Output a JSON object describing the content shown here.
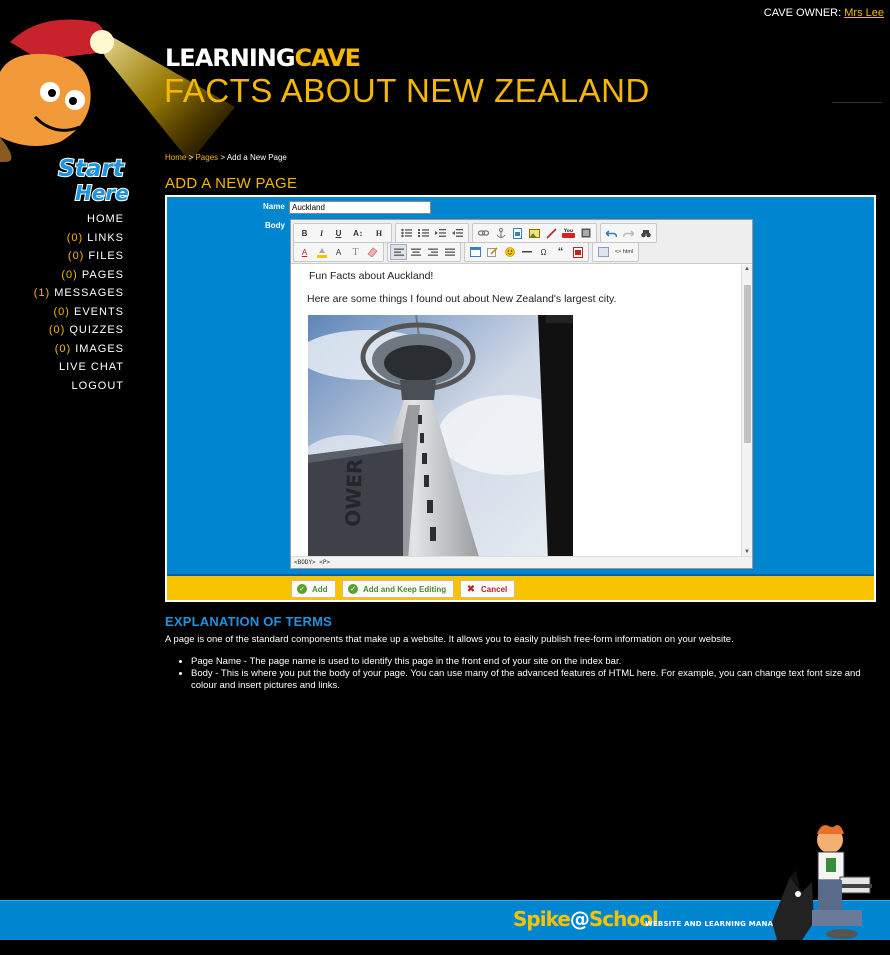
{
  "header": {
    "owner_label": "CAVE OWNER:",
    "owner_name": "Mrs Lee",
    "logo_part1": "LEARNING",
    "logo_part2": "CAVE",
    "site_title": "FACTS ABOUT NEW ZEALAND"
  },
  "start_here": "Start Here",
  "nav": {
    "home": "HOME",
    "links_count": "(0)",
    "links": "LINKS",
    "files_count": "(0)",
    "files": "FILES",
    "pages_count": "(0)",
    "pages": "PAGES",
    "messages_count": "(1)",
    "messages": "MESSAGES",
    "events_count": "(0)",
    "events": "EVENTS",
    "quizzes_count": "(0)",
    "quizzes": "QUIZZES",
    "images_count": "(0)",
    "images": "IMAGES",
    "live_chat": "LIVE CHAT",
    "logout": "LOGOUT"
  },
  "breadcrumb": {
    "home": "Home",
    "sep1": " > ",
    "pages": "Pages",
    "sep2": " > ",
    "current": "Add a New Page"
  },
  "page_heading": "ADD A NEW PAGE",
  "form": {
    "name_label": "Name",
    "name_value": "Auckland",
    "body_label": "Body",
    "editor_title": "Fun Facts about Auckland!",
    "editor_text": "Here are some things I found out about New Zealand's largest city.",
    "status_path": "<BODY> <P>",
    "add_button": "Add",
    "add_keep_button": "Add and Keep Editing",
    "cancel_button": "Cancel"
  },
  "toolbar": {
    "bold": "B",
    "italic": "I",
    "underline": "U",
    "font_size": "A↕",
    "heading": "H",
    "text_style": "T",
    "special_char": "Ω",
    "quote": "“",
    "html": "<> html"
  },
  "explanation": {
    "heading": "EXPLANATION OF TERMS",
    "intro": "A page is one of the standard components that make up a website. It allows you to easily publish free-form information on your website.",
    "items": [
      "Page Name - The page name is used to identify this page in the front end of your site on the index bar.",
      "Body - This is where you put the body of your page. You can use many of the advanced features of HTML here. For example, you can change text font size and colour and insert pictures and links."
    ]
  },
  "footer": {
    "brand_spike": "Spike",
    "brand_at": "@",
    "brand_school": "School",
    "tagline": "WEBSITE AND LEARNING MANAGEMENT"
  },
  "colors": {
    "accent_yellow": "#f5b800",
    "form_blue": "#0086d1",
    "heading_blue": "#1f93dd"
  }
}
